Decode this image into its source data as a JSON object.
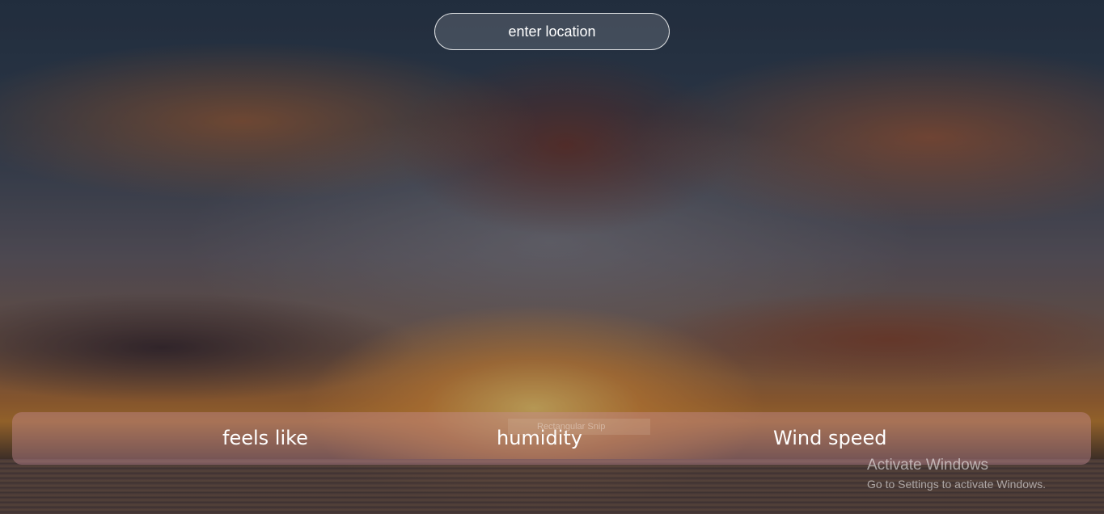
{
  "search": {
    "placeholder": "enter location"
  },
  "stats": {
    "feels_like_label": "feels like",
    "humidity_label": "humidity",
    "wind_speed_label": "Wind speed"
  },
  "overlay": {
    "snip_label": "Rectangular Snip"
  },
  "watermark": {
    "title": "Activate Windows",
    "subtitle": "Go to Settings to activate Windows."
  },
  "colors": {
    "text": "#ffffff",
    "input_border": "#ffffff"
  }
}
